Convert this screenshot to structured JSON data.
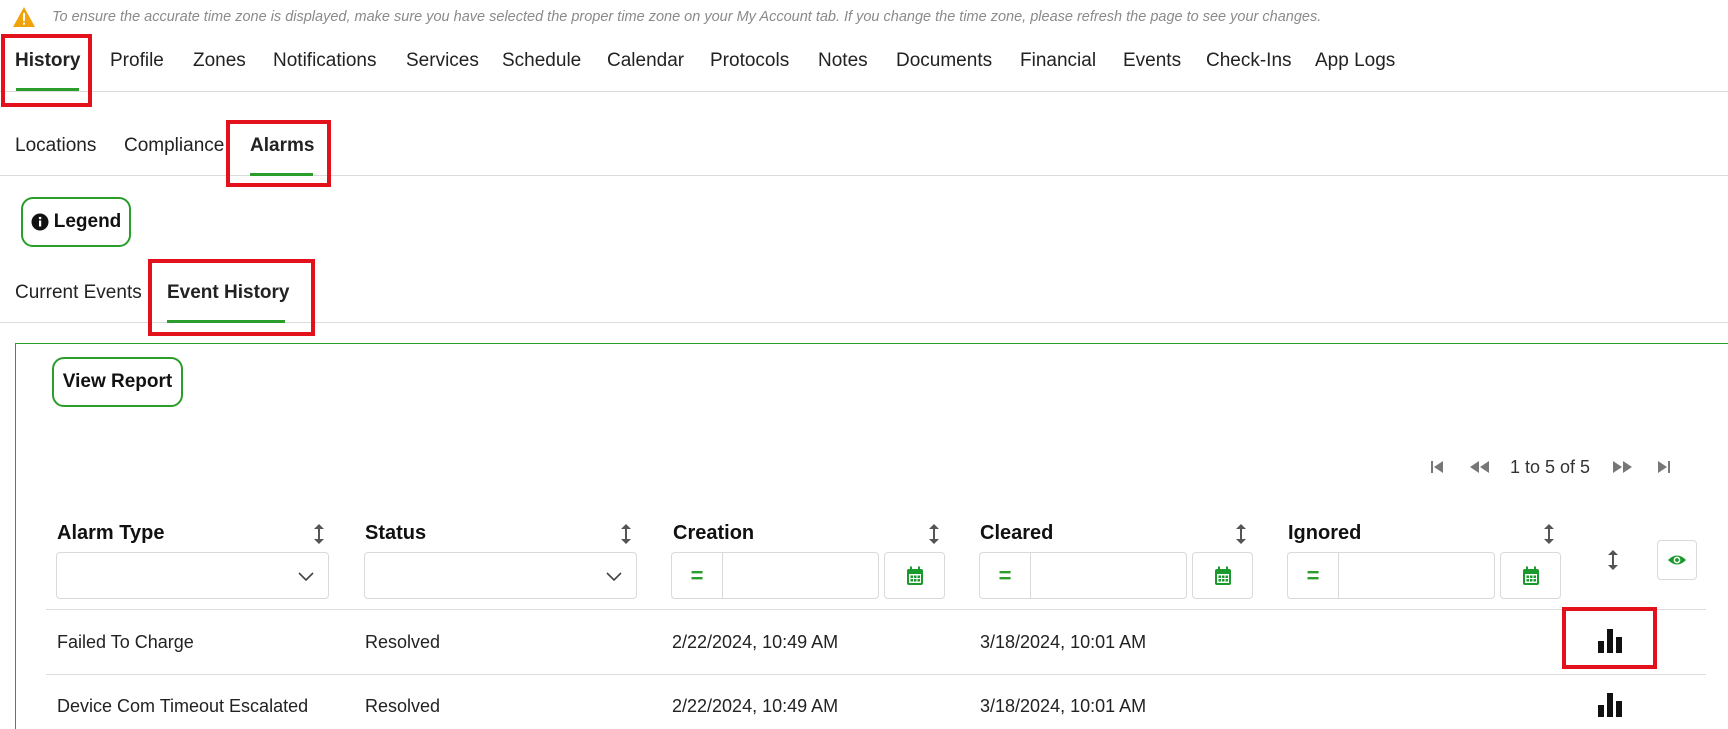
{
  "notice": {
    "text": "To ensure the accurate time zone is displayed, make sure you have selected the proper time zone on your My Account tab. If you change the time zone, please refresh the page to see your changes.",
    "icon": "warning-triangle-icon"
  },
  "main_tabs": [
    "History",
    "Profile",
    "Zones",
    "Notifications",
    "Services",
    "Schedule",
    "Calendar",
    "Protocols",
    "Notes",
    "Documents",
    "Financial",
    "Events",
    "Check-Ins",
    "App Logs"
  ],
  "main_tabs_active": "History",
  "sub_tabs": [
    "Locations",
    "Compliance",
    "Alarms"
  ],
  "sub_tabs_active": "Alarms",
  "legend_label": "Legend",
  "event_tabs": [
    "Current Events",
    "Event History"
  ],
  "event_tabs_active": "Event History",
  "view_report_label": "View Report",
  "pager": {
    "text": "1 to 5 of 5"
  },
  "columns": [
    "Alarm Type",
    "Status",
    "Creation",
    "Cleared",
    "Ignored"
  ],
  "filters": {
    "alarm_type": "",
    "status": "",
    "operator": "=",
    "creation": "",
    "cleared": "",
    "ignored": ""
  },
  "rows": [
    {
      "alarm_type": "Failed To Charge",
      "status": "Resolved",
      "creation": "2/22/2024, 10:49 AM",
      "cleared": "3/18/2024, 10:01 AM",
      "ignored": ""
    },
    {
      "alarm_type": "Device Com Timeout Escalated",
      "status": "Resolved",
      "creation": "2/22/2024, 10:49 AM",
      "cleared": "3/18/2024, 10:01 AM",
      "ignored": ""
    }
  ],
  "colors": {
    "accent_green": "#2a9d2a",
    "highlight_red": "#e3111b",
    "warning_orange": "#f0a30a"
  }
}
